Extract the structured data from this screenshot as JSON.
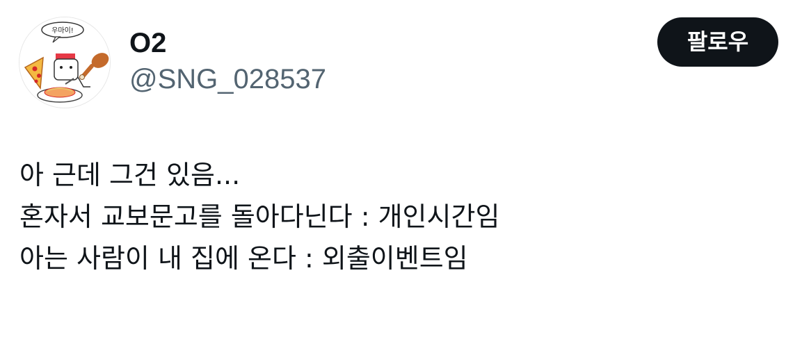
{
  "author": {
    "display_name": "O2",
    "handle": "@SNG_028537",
    "avatar_text": "우마이!"
  },
  "actions": {
    "follow_label": "팔로우"
  },
  "tweet": {
    "lines": [
      "아 근데 그건 있음...",
      "혼자서 교보문고를 돌아다닌다 : 개인시간임",
      "아는 사람이 내 집에 온다 : 외출이벤트임"
    ]
  },
  "colors": {
    "text_primary": "#0f1419",
    "text_secondary": "#536471",
    "button_bg": "#0f1419",
    "button_text": "#ffffff"
  }
}
